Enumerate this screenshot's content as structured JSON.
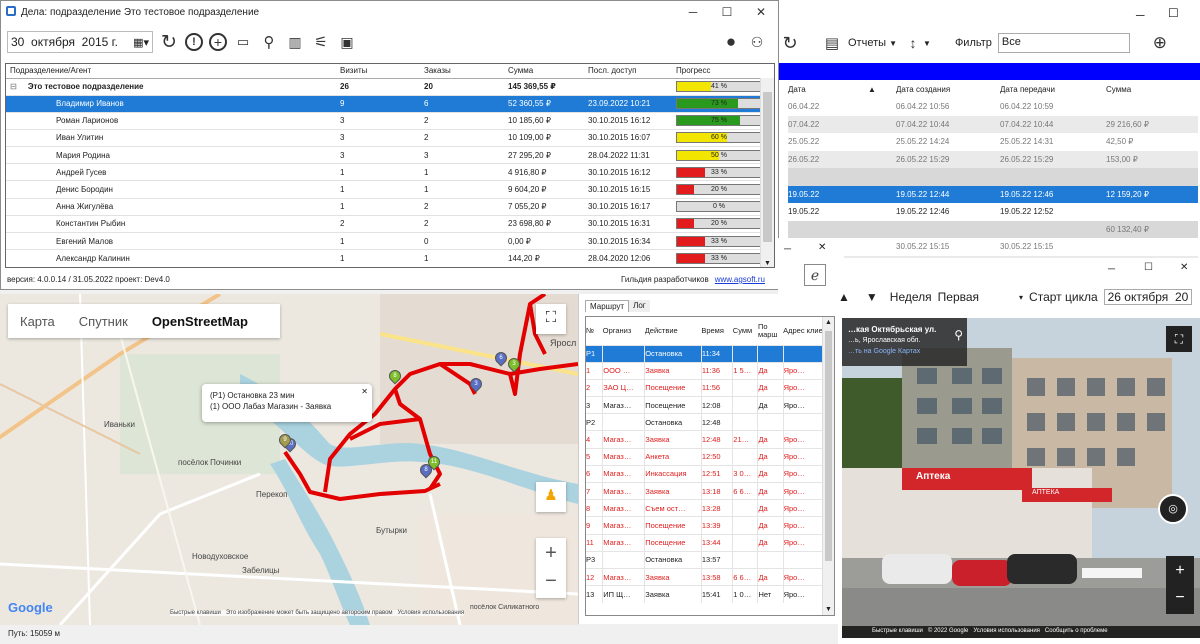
{
  "main_window": {
    "title": "Дела: подразделение Это тестовое подразделение",
    "date": "30  октября  2015 г.",
    "columns": [
      "Подразделение/Агент",
      "Визиты",
      "Заказы",
      "Сумма",
      "Посл. доступ",
      "Прогресс"
    ],
    "group": {
      "name": "Это тестовое подразделение",
      "visits": "26",
      "orders": "20",
      "sum": "145 369,55 ₽",
      "progress_label": "41 %",
      "progress": 0.41
    },
    "rows": [
      {
        "name": "Владимир Иванов",
        "visits": "9",
        "orders": "6",
        "sum": "52 360,55 ₽",
        "last": "23.09.2022 10:21",
        "label": "73 %",
        "p": 0.73,
        "color": "#2a9a1f"
      },
      {
        "name": "Роман Ларионов",
        "visits": "3",
        "orders": "2",
        "sum": "10 185,60 ₽",
        "last": "30.10.2015 16:12",
        "label": "75 %",
        "p": 0.75,
        "color": "#2a9a1f"
      },
      {
        "name": "Иван Улитин",
        "visits": "3",
        "orders": "2",
        "sum": "10 109,00 ₽",
        "last": "30.10.2015 16:07",
        "label": "60 %",
        "p": 0.6,
        "color": "#f2e600"
      },
      {
        "name": "Мария Родина",
        "visits": "3",
        "orders": "3",
        "sum": "27 295,20 ₽",
        "last": "28.04.2022 11:31",
        "label": "50 %",
        "p": 0.5,
        "color": "#f2e600"
      },
      {
        "name": "Андрей Гусев",
        "visits": "1",
        "orders": "1",
        "sum": "4 916,80 ₽",
        "last": "30.10.2015 16:12",
        "label": "33 %",
        "p": 0.33,
        "color": "#e21c1c"
      },
      {
        "name": "Денис Бородин",
        "visits": "1",
        "orders": "1",
        "sum": "9 604,20 ₽",
        "last": "30.10.2015 16:15",
        "label": "20 %",
        "p": 0.2,
        "color": "#e21c1c"
      },
      {
        "name": "Анна Жигулёва",
        "visits": "1",
        "orders": "2",
        "sum": "7 055,20 ₽",
        "last": "30.10.2015 16:17",
        "label": "0 %",
        "p": 0,
        "color": "#e21c1c"
      },
      {
        "name": "Константин Рыбин",
        "visits": "2",
        "orders": "2",
        "sum": "23 698,80 ₽",
        "last": "30.10.2015 16:31",
        "label": "20 %",
        "p": 0.2,
        "color": "#e21c1c"
      },
      {
        "name": "Евгений Малов",
        "visits": "1",
        "orders": "0",
        "sum": "0,00 ₽",
        "last": "30.10.2015 16:34",
        "label": "33 %",
        "p": 0.33,
        "color": "#e21c1c"
      },
      {
        "name": "Александр Калинин",
        "visits": "1",
        "orders": "1",
        "sum": "144,20 ₽",
        "last": "28.04.2020 12:06",
        "label": "33 %",
        "p": 0.33,
        "color": "#e21c1c"
      }
    ],
    "status_left": "версия: 4.0.0.14 / 31.05.2022 проект: Dev4.0",
    "status_right_label": "Гильдия разработчиков",
    "status_link": "www.agsoft.ru"
  },
  "back_window": {
    "reports_label": "Отчеты",
    "filter_label": "Фильтр",
    "filter_value": "Все",
    "columns": [
      "Дата",
      "Дата создания",
      "Дата передачи",
      "Сумма"
    ],
    "rows": [
      [
        "06.04.22",
        "06.04.22 10:56",
        "06.04.22 10:59",
        ""
      ],
      [
        "07.04.22",
        "07.04.22 10:44",
        "07.04.22 10:44",
        "29 216,60 ₽"
      ],
      [
        "25.05.22",
        "25.05.22 14:24",
        "25.05.22 14:31",
        "42,50 ₽"
      ],
      [
        "26.05.22",
        "26.05.22 15:29",
        "26.05.22 15:29",
        "153,00 ₽"
      ],
      [
        "",
        "",
        "",
        ""
      ],
      [
        "19.05.22",
        "19.05.22 12:44",
        "19.05.22 12:46",
        "12 159,20 ₽"
      ],
      [
        "19.05.22",
        "19.05.22 12:46",
        "19.05.22 12:52",
        ""
      ],
      [
        "",
        "",
        "",
        "60 132,40 ₽"
      ],
      [
        "30.05.22",
        "30.05.22 15:15",
        "30.05.22 15:15",
        ""
      ],
      [
        "",
        "",
        "",
        ""
      ]
    ]
  },
  "map": {
    "tabs": [
      "Карта",
      "Спутник",
      "OpenStreetMap"
    ],
    "popup_line1": "(P1) Остановка 23 мин",
    "popup_line2": "(1) ООО Лабаз Магазин - Заявка",
    "places": [
      "Иваньки",
      "посёлок Починки",
      "Перекоп",
      "Бутырки",
      "Новодуховское",
      "Забелицы",
      "Яросл",
      "посёлок Силикатного"
    ],
    "google": "Google",
    "footer": "Быстрые клавиши   Это изображение может быть защищено авторским правом   Условия использования",
    "path_label": "Путь: 15059 м"
  },
  "route": {
    "tabs": [
      "Маршрут",
      "Лог"
    ],
    "columns": [
      "№",
      "Организ",
      "Действие",
      "Время",
      "Сумм",
      "По марш",
      "Адрес клиент"
    ],
    "rows": [
      {
        "c": [
          "P1",
          "",
          "Остановка",
          "11:34",
          "",
          "",
          ""
        ],
        "t": "sel"
      },
      {
        "c": [
          "1",
          "ООО …",
          "Заявка",
          "11:36",
          "1 5…",
          "Да",
          "Яро…"
        ],
        "t": "red"
      },
      {
        "c": [
          "2",
          "ЗАО Ц…",
          "Посещение",
          "11:56",
          "",
          "Да",
          "Яро…"
        ],
        "t": "red"
      },
      {
        "c": [
          "3",
          "Магаз…",
          "Посещение",
          "12:08",
          "",
          "Да",
          "Яро…"
        ],
        "t": "black"
      },
      {
        "c": [
          "P2",
          "",
          "Остановка",
          "12:48",
          "",
          "",
          ""
        ],
        "t": "black"
      },
      {
        "c": [
          "4",
          "Магаз…",
          "Заявка",
          "12:48",
          "21…",
          "Да",
          "Яро…"
        ],
        "t": "red"
      },
      {
        "c": [
          "5",
          "Магаз…",
          "Анкета",
          "12:50",
          "",
          "Да",
          "Яро…"
        ],
        "t": "red"
      },
      {
        "c": [
          "6",
          "Магаз…",
          "Инкассация",
          "12:51",
          "3 0…",
          "Да",
          "Яро…"
        ],
        "t": "red"
      },
      {
        "c": [
          "7",
          "Магаз…",
          "Заявка",
          "13:18",
          "6 6…",
          "Да",
          "Яро…"
        ],
        "t": "red"
      },
      {
        "c": [
          "8",
          "Магаз…",
          "Съем ост…",
          "13:28",
          "",
          "Да",
          "Яро…"
        ],
        "t": "red"
      },
      {
        "c": [
          "9",
          "Магаз…",
          "Посещение",
          "13:39",
          "",
          "Да",
          "Яро…"
        ],
        "t": "red"
      },
      {
        "c": [
          "11",
          "Магаз…",
          "Посещение",
          "13:44",
          "",
          "Да",
          "Яро…"
        ],
        "t": "red"
      },
      {
        "c": [
          "P3",
          "",
          "Остановка",
          "13:57",
          "",
          "",
          ""
        ],
        "t": "black"
      },
      {
        "c": [
          "12",
          "Магаз…",
          "Заявка",
          "13:58",
          "6 6…",
          "Да",
          "Яро…"
        ],
        "t": "red"
      },
      {
        "c": [
          "13",
          "ИП Щ…",
          "Заявка",
          "15:41",
          "1 0…",
          "Нет",
          "Яро…"
        ],
        "t": "black"
      }
    ]
  },
  "street": {
    "nav_label": "Неделя",
    "nav_value": "Первая",
    "cycle_label": "Старт цикла",
    "cycle_value": "26 октября  20",
    "place_name": "…кая Октябрьская ул.",
    "place_region": "…ь, Ярославская обл.",
    "place_link": "…ть на Google Картах",
    "sign1": "Аптека",
    "sign2": "АПТЕКА",
    "footer": "Быстрые клавиши   © 2022 Google   Условия использования   Сообщить о проблеме"
  }
}
